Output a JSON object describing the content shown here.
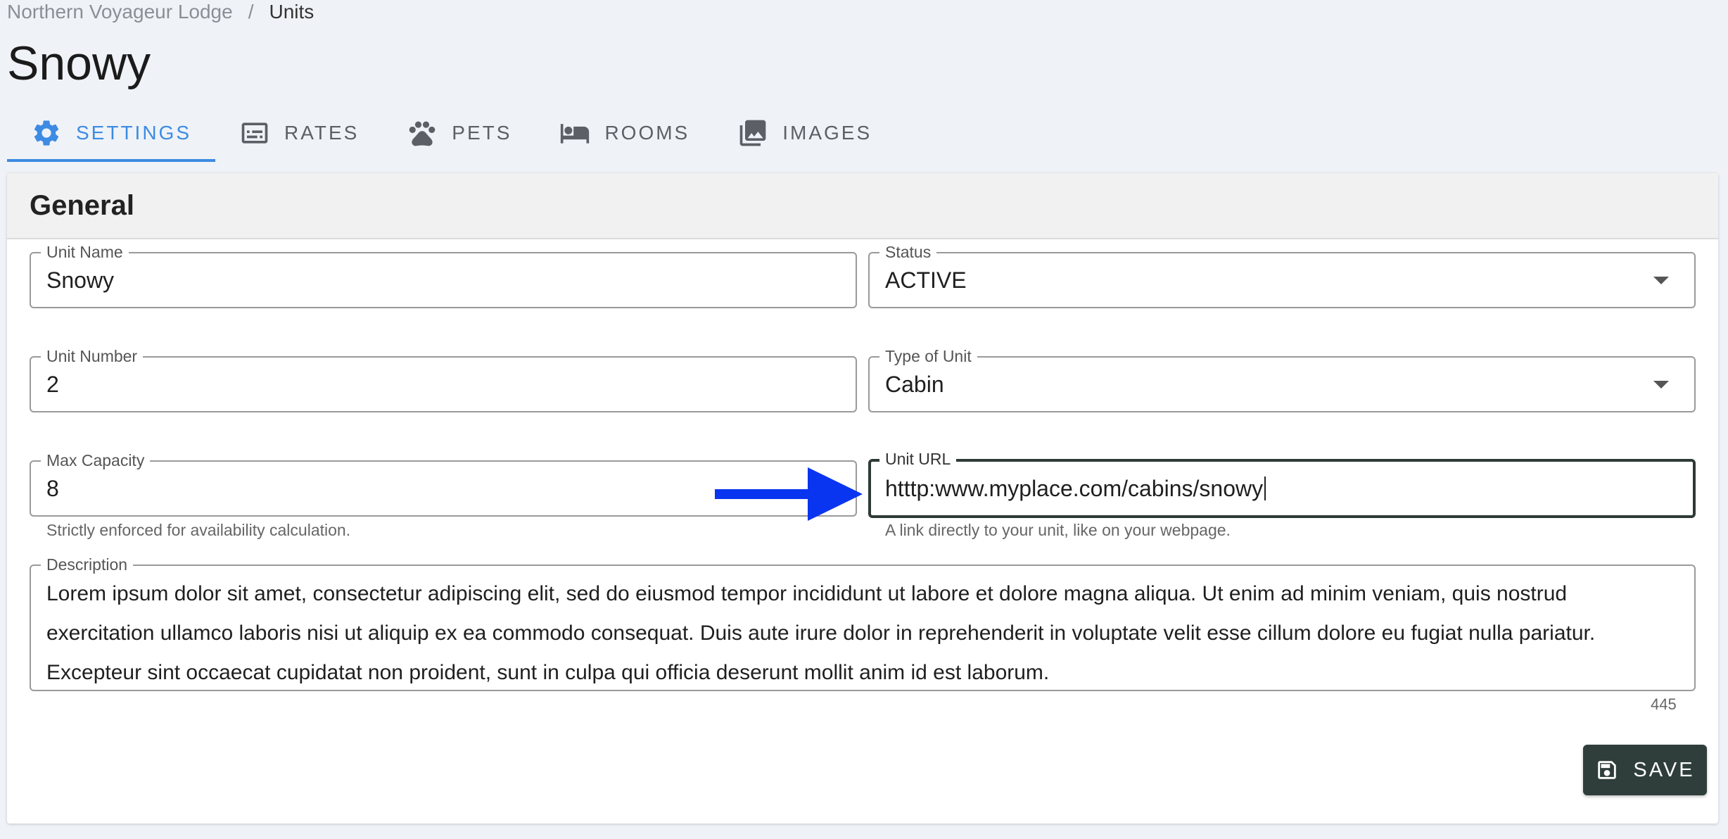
{
  "breadcrumb": {
    "parent": "Northern Voyageur Lodge",
    "separator": "/",
    "current": "Units"
  },
  "page_title": "Snowy",
  "tabs": [
    {
      "label": "SETTINGS",
      "icon": "gear-icon",
      "active": true
    },
    {
      "label": "RATES",
      "icon": "rates-card-icon",
      "active": false
    },
    {
      "label": "PETS",
      "icon": "paw-icon",
      "active": false
    },
    {
      "label": "ROOMS",
      "icon": "bed-icon",
      "active": false
    },
    {
      "label": "IMAGES",
      "icon": "images-icon",
      "active": false
    }
  ],
  "section": {
    "title": "General"
  },
  "fields": {
    "unit_name": {
      "label": "Unit Name",
      "value": "Snowy"
    },
    "status": {
      "label": "Status",
      "value": "ACTIVE"
    },
    "unit_number": {
      "label": "Unit Number",
      "value": "2"
    },
    "type_of_unit": {
      "label": "Type of Unit",
      "value": "Cabin"
    },
    "max_capacity": {
      "label": "Max Capacity",
      "value": "8",
      "helper": "Strictly enforced for availability calculation."
    },
    "unit_url": {
      "label": "Unit URL",
      "value": "htttp:www.myplace.com/cabins/snowy",
      "helper": "A link directly to your unit, like on your webpage."
    },
    "description": {
      "label": "Description",
      "value": "Lorem ipsum dolor sit amet, consectetur adipiscing elit, sed do eiusmod tempor incididunt ut labore et dolore magna aliqua. Ut enim ad minim veniam, quis nostrud exercitation ullamco laboris nisi ut aliquip ex ea commodo consequat. Duis aute irure dolor in reprehenderit in voluptate velit esse cillum dolore eu fugiat nulla pariatur. Excepteur sint occaecat cupidatat non proident, sunt in culpa qui officia deserunt mollit anim id est laborum.",
      "char_count": "445"
    }
  },
  "save_button": {
    "label": "SAVE",
    "icon": "floppy-disk-icon"
  },
  "colors": {
    "accent": "#3d8be3",
    "save_bg": "#2f3e3a",
    "annotation_arrow": "#0a35f0"
  }
}
